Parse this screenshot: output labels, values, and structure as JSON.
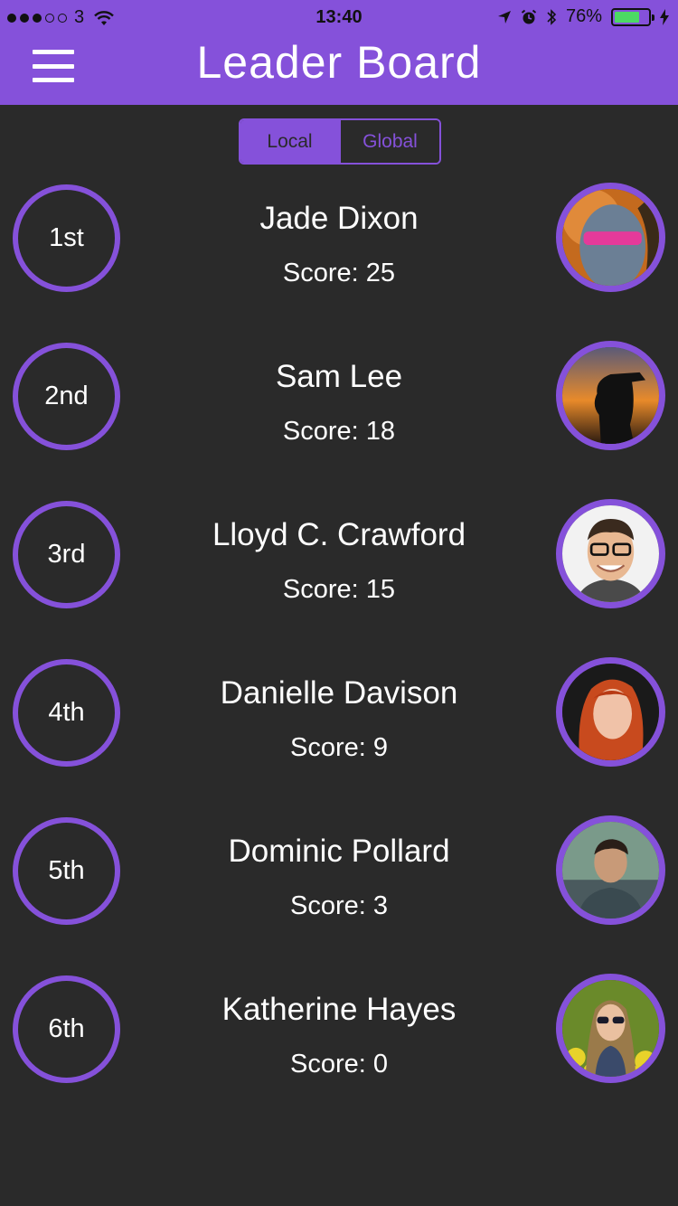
{
  "status_bar": {
    "carrier": "3",
    "time": "13:40",
    "battery_percent": "76%",
    "battery_level": 0.76,
    "signal_bars": 3,
    "icons": [
      "signal-icon",
      "wifi-icon",
      "location-icon",
      "alarm-icon",
      "bluetooth-icon",
      "battery-icon",
      "charging-icon"
    ]
  },
  "header": {
    "title": "Leader Board",
    "menu_icon": "hamburger-menu-icon"
  },
  "segment": {
    "options": [
      "Local",
      "Global"
    ],
    "selected": "Local"
  },
  "leaderboard": [
    {
      "rank": "1st",
      "name": "Jade Dixon",
      "score": "Score: 25"
    },
    {
      "rank": "2nd",
      "name": "Sam Lee",
      "score": "Score: 18"
    },
    {
      "rank": "3rd",
      "name": "Lloyd C. Crawford",
      "score": "Score: 15"
    },
    {
      "rank": "4th",
      "name": "Danielle Davison",
      "score": "Score: 9"
    },
    {
      "rank": "5th",
      "name": "Dominic Pollard",
      "score": "Score: 3"
    },
    {
      "rank": "6th",
      "name": "Katherine Hayes",
      "score": "Score: 0"
    }
  ],
  "colors": {
    "accent": "#8551da",
    "background": "#2a2a2a",
    "text": "#ffffff"
  }
}
